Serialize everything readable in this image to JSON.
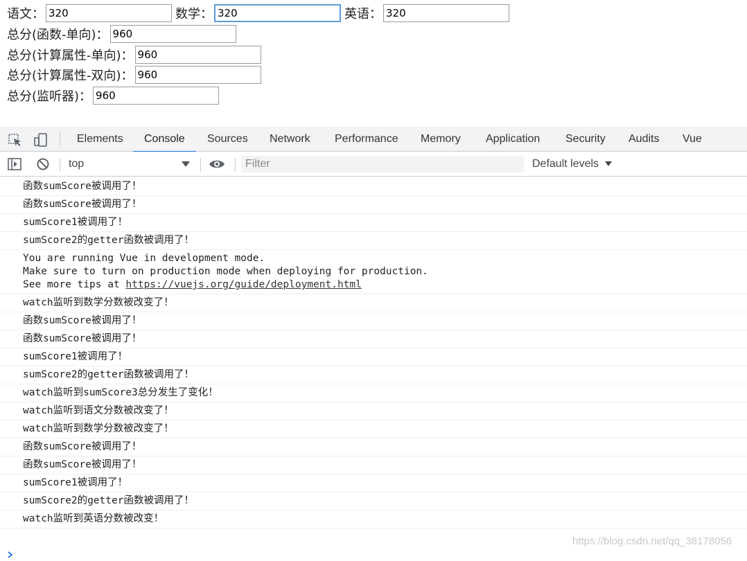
{
  "form": {
    "chinese_label": "语文：",
    "chinese_value": "320",
    "math_label": "数学：",
    "math_value": "320",
    "english_label": "英语：",
    "english_value": "320",
    "total_func_label": "总分(函数-单向)：",
    "total_func_value": "960",
    "total_computed_one_label": "总分(计算属性-单向)：",
    "total_computed_one_value": "960",
    "total_computed_two_label": "总分(计算属性-双向)：",
    "total_computed_two_value": "960",
    "total_watch_label": "总分(监听器)：",
    "total_watch_value": "960"
  },
  "devtools": {
    "tabs": [
      {
        "label": "Elements"
      },
      {
        "label": "Console",
        "active": true
      },
      {
        "label": "Sources"
      },
      {
        "label": "Network"
      },
      {
        "label": "Performance"
      },
      {
        "label": "Memory"
      },
      {
        "label": "Application"
      },
      {
        "label": "Security"
      },
      {
        "label": "Audits"
      },
      {
        "label": "Vue"
      }
    ],
    "context": "top",
    "filter_placeholder": "Filter",
    "levels": "Default levels",
    "accent_color": "#1a73e8"
  },
  "console": {
    "messages": [
      {
        "lines": [
          "函数sumScore被调用了！"
        ]
      },
      {
        "lines": [
          "函数sumScore被调用了！"
        ]
      },
      {
        "lines": [
          "sumScore1被调用了！"
        ]
      },
      {
        "lines": [
          "sumScore2的getter函数被调用了！"
        ]
      },
      {
        "lines": [
          "You are running Vue in development mode.",
          "Make sure to turn on production mode when deploying for production."
        ],
        "tips_prefix": "See more tips at ",
        "link": "https://vuejs.org/guide/deployment.html"
      },
      {
        "lines": [
          "watch监听到数学分数被改变了！"
        ]
      },
      {
        "lines": [
          "函数sumScore被调用了！"
        ]
      },
      {
        "lines": [
          "函数sumScore被调用了！"
        ]
      },
      {
        "lines": [
          "sumScore1被调用了！"
        ]
      },
      {
        "lines": [
          "sumScore2的getter函数被调用了！"
        ]
      },
      {
        "lines": [
          "watch监听到sumScore3总分发生了变化！"
        ]
      },
      {
        "lines": [
          "watch监听到语文分数被改变了！"
        ]
      },
      {
        "lines": [
          "watch监听到数学分数被改变了！"
        ]
      },
      {
        "lines": [
          "函数sumScore被调用了！"
        ]
      },
      {
        "lines": [
          "函数sumScore被调用了！"
        ]
      },
      {
        "lines": [
          "sumScore1被调用了！"
        ]
      },
      {
        "lines": [
          "sumScore2的getter函数被调用了！"
        ]
      },
      {
        "lines": [
          "watch监听到英语分数被改变！"
        ]
      }
    ]
  },
  "watermark": "https://blog.csdn.net/qq_38178056"
}
